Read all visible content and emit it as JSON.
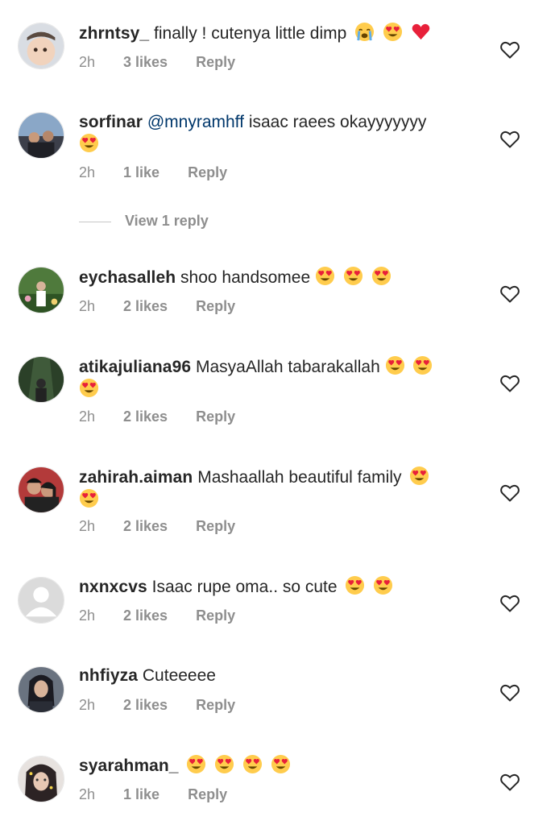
{
  "comments": [
    {
      "username": "zhrntsy_",
      "mention": "",
      "text": "finally ! cutenya little dimp",
      "emojis": [
        "loudly-crying-face",
        "heart-eyes",
        "red-heart"
      ],
      "time": "2h",
      "likes": "3 likes",
      "reply": "Reply"
    },
    {
      "username": "sorfinar",
      "mention": "@mnyramhff",
      "text": "isaac raees okayyyyyyy",
      "emojis": [
        "heart-eyes"
      ],
      "time": "2h",
      "likes": "1 like",
      "reply": "Reply"
    },
    {
      "username": "eychasalleh",
      "mention": "",
      "text": "shoo handsomee",
      "emojis": [
        "heart-eyes",
        "heart-eyes",
        "heart-eyes"
      ],
      "time": "2h",
      "likes": "2 likes",
      "reply": "Reply"
    },
    {
      "username": "atikajuliana96",
      "mention": "",
      "text": "MasyaAllah tabarakallah",
      "emojis": [
        "heart-eyes",
        "heart-eyes",
        "heart-eyes"
      ],
      "time": "2h",
      "likes": "2 likes",
      "reply": "Reply"
    },
    {
      "username": "zahirah.aiman",
      "mention": "",
      "text": "Mashaallah beautiful family",
      "emojis": [
        "heart-eyes",
        "heart-eyes"
      ],
      "time": "2h",
      "likes": "2 likes",
      "reply": "Reply"
    },
    {
      "username": "nxnxcvs",
      "mention": "",
      "text": "Isaac rupe oma.. so cute",
      "emojis": [
        "heart-eyes",
        "heart-eyes"
      ],
      "time": "2h",
      "likes": "2 likes",
      "reply": "Reply"
    },
    {
      "username": "nhfiyza",
      "mention": "",
      "text": "Cuteeeee",
      "emojis": [],
      "time": "2h",
      "likes": "2 likes",
      "reply": "Reply"
    },
    {
      "username": "syarahman_",
      "mention": "",
      "text": "",
      "emojis": [
        "heart-eyes",
        "heart-eyes",
        "heart-eyes",
        "heart-eyes"
      ],
      "time": "2h",
      "likes": "1 like",
      "reply": "Reply"
    }
  ],
  "view_replies": "View 1 reply",
  "icons": {
    "like": "heart-outline-icon"
  },
  "colors": {
    "text": "#262626",
    "meta": "#8e8e8e",
    "mention": "#00376b",
    "emoji_face": "#ffcc4d",
    "emoji_heart": "#e8203a"
  }
}
